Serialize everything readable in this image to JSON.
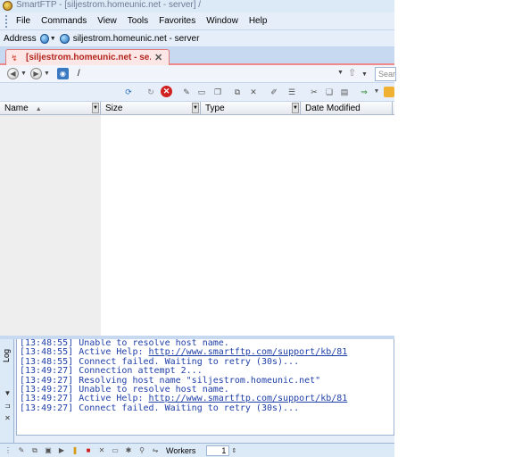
{
  "window": {
    "title": "SmartFTP - [siljestrom.homeunic.net - server] /"
  },
  "menu": {
    "items": [
      "File",
      "Commands",
      "View",
      "Tools",
      "Favorites",
      "Window",
      "Help"
    ]
  },
  "address": {
    "label": "Address",
    "value": "siljestrom.homeunic.net - server"
  },
  "tab": {
    "label": "[siljestrom.homeunic.net - se...",
    "close": "✕"
  },
  "pathbar": {
    "path": "/",
    "search_placeholder": "Sear"
  },
  "columns": [
    {
      "label": "Name",
      "sort": "▲"
    },
    {
      "label": "Size"
    },
    {
      "label": "Type"
    },
    {
      "label": "Date Modified"
    }
  ],
  "log": {
    "side_label": "Log",
    "lines": [
      {
        "time": "[13:48:55]",
        "text": "Unable to resolve host name."
      },
      {
        "time": "[13:48:55]",
        "text": "Active Help: ",
        "link": "http://www.smartftp.com/support/kb/81"
      },
      {
        "time": "[13:48:55]",
        "text": "Connect failed. Waiting to retry (30s)..."
      },
      {
        "time": "[13:49:27]",
        "text": "Connection attempt 2..."
      },
      {
        "time": "[13:49:27]",
        "text": "Resolving host name \"siljestrom.homeunic.net\""
      },
      {
        "time": "[13:49:27]",
        "text": "Unable to resolve host name."
      },
      {
        "time": "[13:49:27]",
        "text": "Active Help: ",
        "link": "http://www.smartftp.com/support/kb/81"
      },
      {
        "time": "[13:49:27]",
        "text": "Connect failed. Waiting to retry (30s)..."
      }
    ]
  },
  "statusbar": {
    "workers_label": "Workers",
    "workers_value": "1"
  },
  "icons": {
    "back": "back-icon",
    "forward": "forward-icon",
    "refresh": "refresh-icon",
    "stop": "stop-icon",
    "cut": "cut-icon",
    "copy": "copy-icon",
    "paste": "paste-icon",
    "delete": "delete-icon"
  },
  "colors": {
    "tab_accent": "#b3261e",
    "log_text": "#1f3fa8",
    "chrome_bg": "#dce9f7"
  }
}
